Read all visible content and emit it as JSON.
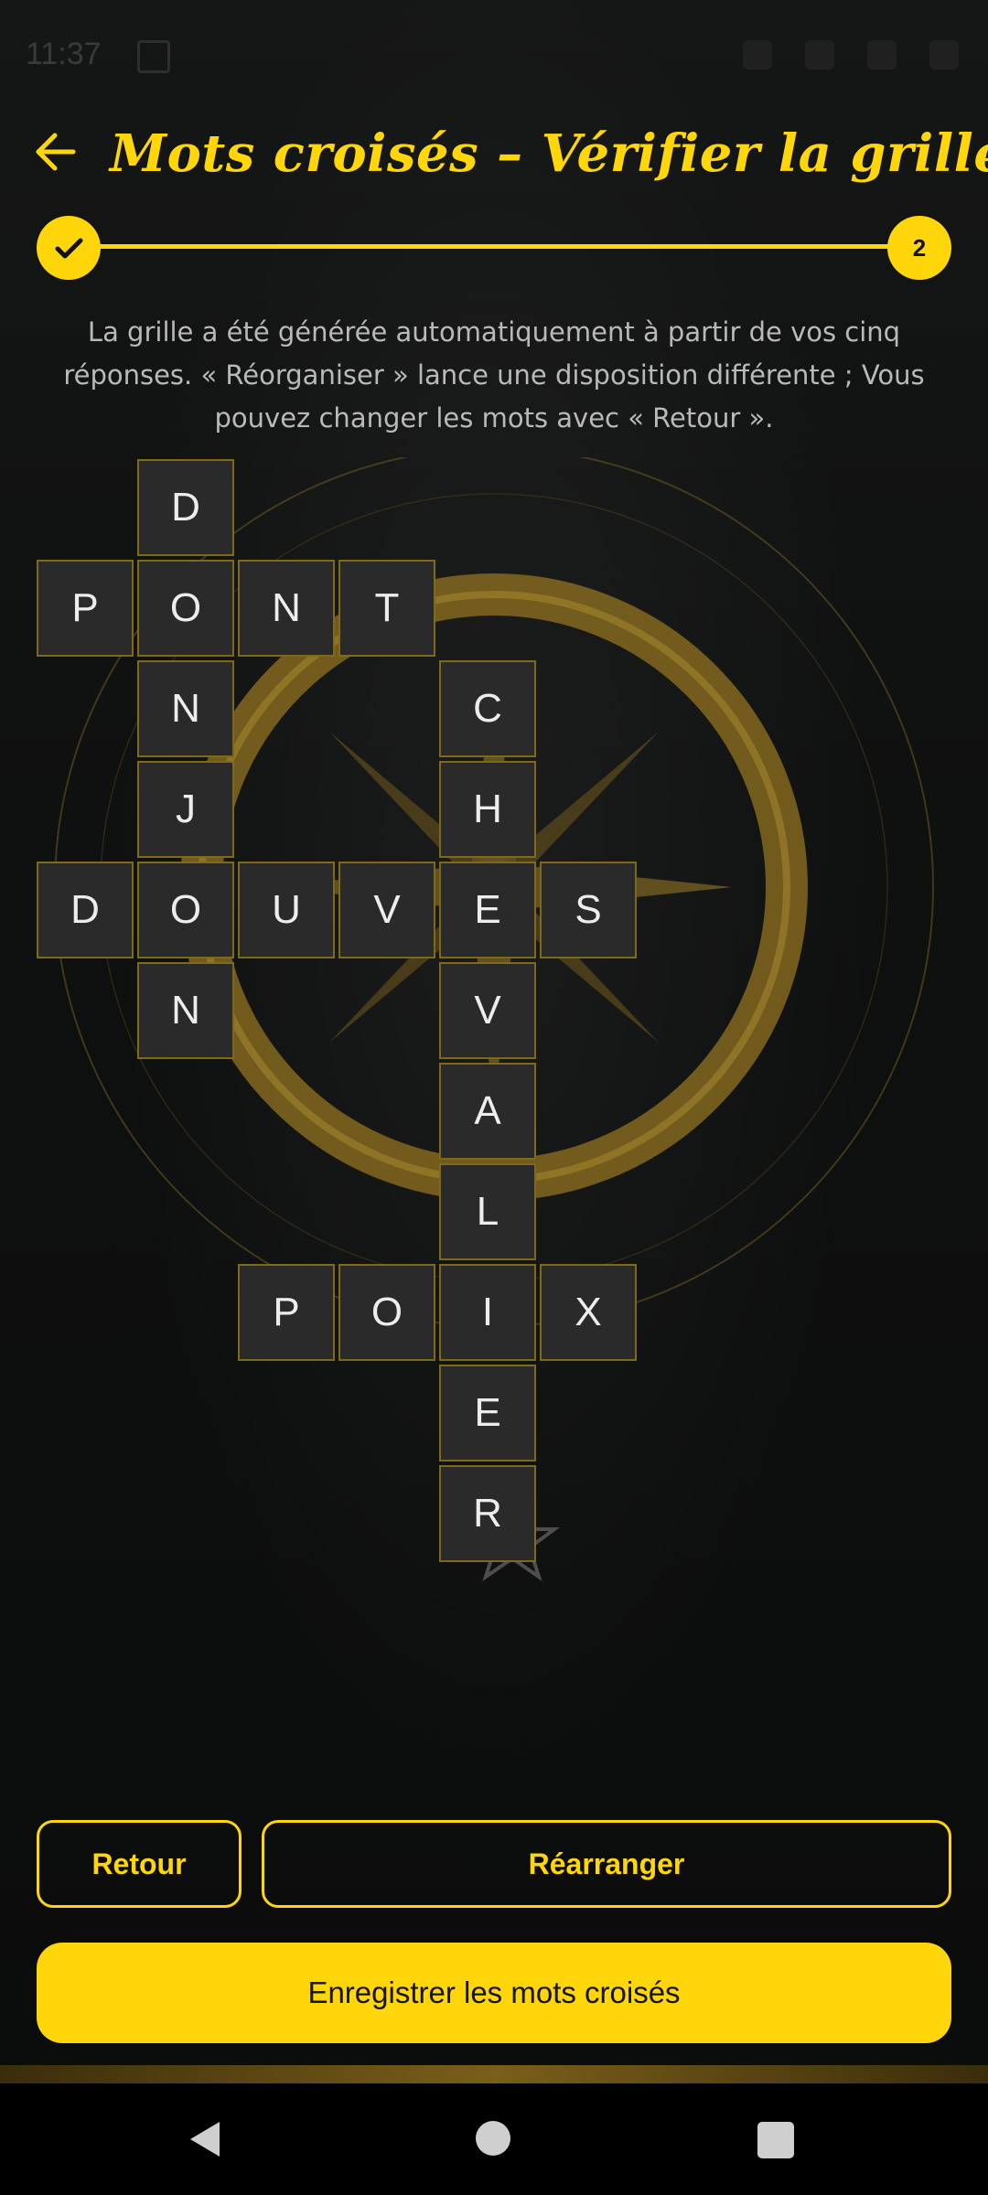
{
  "status_bar": {
    "time": "11:37"
  },
  "header": {
    "title": "Mots croisés – Vérifier la grille"
  },
  "stepper": {
    "current_step": "2"
  },
  "description": "La grille a été générée automatiquement à partir de vos cinq réponses. « Réorganiser » lance une disposition différente ; Vous pouvez changer les mots avec « Retour ».",
  "grid": {
    "cells": [
      {
        "r": 0,
        "c": 1,
        "l": "D"
      },
      {
        "r": 1,
        "c": 0,
        "l": "P"
      },
      {
        "r": 1,
        "c": 1,
        "l": "O"
      },
      {
        "r": 1,
        "c": 2,
        "l": "N"
      },
      {
        "r": 1,
        "c": 3,
        "l": "T"
      },
      {
        "r": 2,
        "c": 1,
        "l": "N"
      },
      {
        "r": 2,
        "c": 4,
        "l": "C"
      },
      {
        "r": 3,
        "c": 1,
        "l": "J"
      },
      {
        "r": 3,
        "c": 4,
        "l": "H"
      },
      {
        "r": 4,
        "c": 0,
        "l": "D"
      },
      {
        "r": 4,
        "c": 1,
        "l": "O"
      },
      {
        "r": 4,
        "c": 2,
        "l": "U"
      },
      {
        "r": 4,
        "c": 3,
        "l": "V"
      },
      {
        "r": 4,
        "c": 4,
        "l": "E"
      },
      {
        "r": 4,
        "c": 5,
        "l": "S"
      },
      {
        "r": 5,
        "c": 1,
        "l": "N"
      },
      {
        "r": 5,
        "c": 4,
        "l": "V"
      },
      {
        "r": 6,
        "c": 4,
        "l": "A"
      },
      {
        "r": 7,
        "c": 4,
        "l": "L"
      },
      {
        "r": 8,
        "c": 2,
        "l": "P"
      },
      {
        "r": 8,
        "c": 3,
        "l": "O"
      },
      {
        "r": 8,
        "c": 4,
        "l": "I"
      },
      {
        "r": 8,
        "c": 5,
        "l": "X"
      },
      {
        "r": 9,
        "c": 4,
        "l": "E"
      },
      {
        "r": 10,
        "c": 4,
        "l": "R"
      }
    ]
  },
  "buttons": {
    "back": "Retour",
    "rearrange": "Réarranger",
    "save": "Enregistrer les mots croisés"
  },
  "colors": {
    "accent": "#ffd60a",
    "cell_bg": "#2a2a2a",
    "cell_border": "#7e6a1a"
  }
}
